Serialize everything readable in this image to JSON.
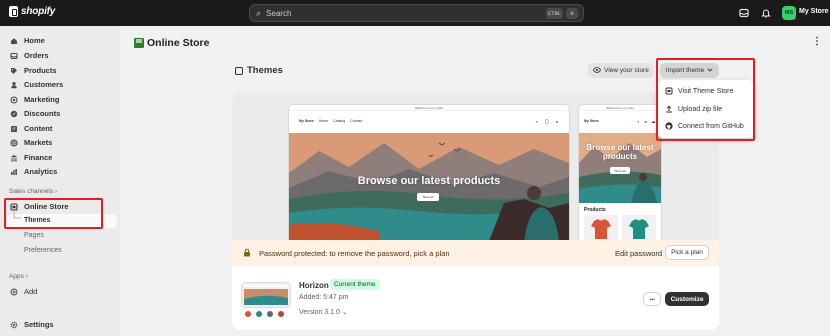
{
  "topbar": {
    "logo_text": "shopify",
    "search_placeholder": "Search",
    "shortcut_key1": "CTRL",
    "shortcut_key2": "K",
    "avatar_initials": "MS",
    "store_name": "My Store"
  },
  "sidebar": {
    "items": [
      {
        "label": "Home",
        "icon": "home-icon"
      },
      {
        "label": "Orders",
        "icon": "orders-icon"
      },
      {
        "label": "Products",
        "icon": "tag-icon"
      },
      {
        "label": "Customers",
        "icon": "person-icon"
      },
      {
        "label": "Marketing",
        "icon": "target-icon"
      },
      {
        "label": "Discounts",
        "icon": "discount-icon"
      },
      {
        "label": "Content",
        "icon": "content-icon"
      },
      {
        "label": "Markets",
        "icon": "globe-icon"
      },
      {
        "label": "Finance",
        "icon": "bank-icon"
      },
      {
        "label": "Analytics",
        "icon": "chart-icon"
      }
    ],
    "sales_channels_label": "Sales channels",
    "online_store_label": "Online Store",
    "online_store_sub": [
      "Themes",
      "Pages",
      "Preferences"
    ],
    "apps_label": "Apps",
    "add_label": "Add",
    "settings_label": "Settings"
  },
  "page": {
    "title": "Online Store",
    "section_title": "Themes",
    "view_store_label": "View your store",
    "import_theme_label": "Import theme"
  },
  "import_menu": {
    "items": [
      {
        "label": "Visit Theme Store",
        "icon": "store-icon"
      },
      {
        "label": "Upload zip file",
        "icon": "upload-icon"
      },
      {
        "label": "Connect from GitHub",
        "icon": "github-icon"
      }
    ]
  },
  "preview": {
    "announcement": "Welcome to my store",
    "store_name": "My Store",
    "nav": [
      "Home",
      "Catalog",
      "Contact"
    ],
    "hero_text": "Browse our latest products",
    "mobile_hero_text": "Browse our latest products",
    "shop_button": "Shop all",
    "products_label": "Products"
  },
  "password_banner": {
    "text": "Password protected: to remove the password, pick a plan",
    "edit_label": "Edit password",
    "plan_label": "Pick a plan"
  },
  "current_theme": {
    "name": "Horizon",
    "badge": "Current theme",
    "added": "Added: 5:47 pm",
    "version": "Version 3.1.0",
    "customize_label": "Customize",
    "more_label": "···"
  },
  "colors": {
    "accent_green": "#36d16a",
    "highlight_red": "#e02020",
    "badge_bg": "#cdfee1",
    "banner_bg": "#fff1e3"
  }
}
